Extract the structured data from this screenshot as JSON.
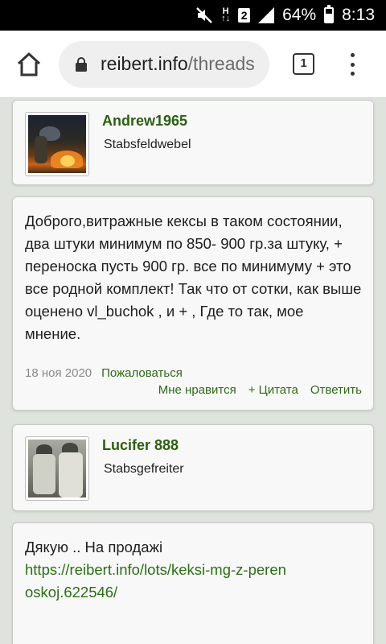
{
  "status_bar": {
    "ht_label": "H\n↑↓",
    "sim_slot": "2",
    "battery_text": "64%",
    "battery_level": 0.64,
    "time": "8:13",
    "icons": [
      "mute-icon",
      "signal-icon",
      "battery-icon"
    ]
  },
  "browser": {
    "url_domain": "reibert.info",
    "url_path": "/threads",
    "tab_count": "1"
  },
  "posts": [
    {
      "user": {
        "name": "Andrew1965",
        "rank": "Stabsfeldwebel"
      }
    },
    {
      "message": {
        "text": "Доброго,витражные кексы в таком состоянии, два штуки минимум по 850- 900 гр.за штуку, + переноска пусть 900 гр. все по минимуму + это все родной комплект! Так что от сотки, как выше оценено vl_buchok , и + , Где то так, мое мнение.",
        "date": "18 ноя 2020",
        "report_label": "Пожаловаться",
        "actions": {
          "like": "Мне нравится",
          "quote": "+ Цитата",
          "reply": "Ответить"
        }
      }
    },
    {
      "user": {
        "name": "Lucifer 888",
        "rank": "Stabsgefreiter"
      }
    },
    {
      "message": {
        "text": "Дякую .. На продажі",
        "link": "https://reibert.info/lots/keksi-mg-z-perenoskoj.622546/"
      }
    }
  ],
  "colors": {
    "accent_green": "#2b5f12",
    "link_green": "#2b6e14",
    "page_bg": "#dfe3dd"
  }
}
